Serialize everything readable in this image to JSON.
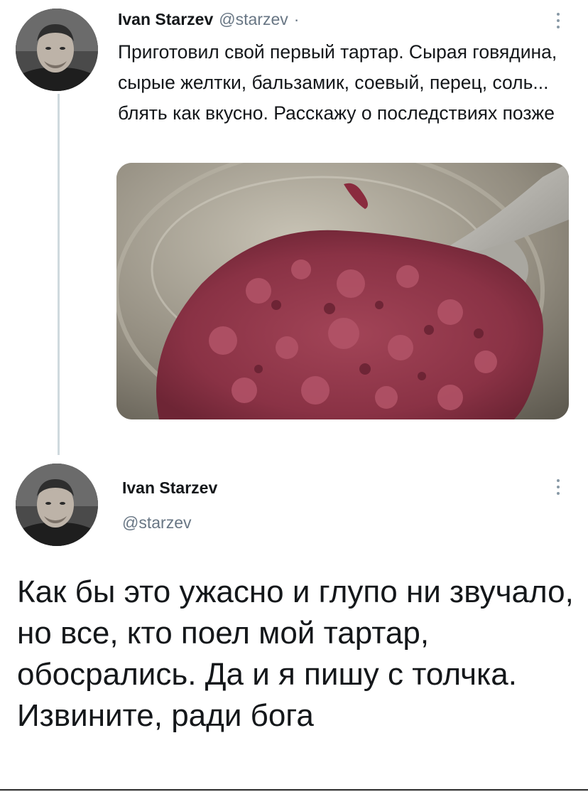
{
  "colors": {
    "text_primary": "#14171a",
    "text_secondary": "#687684",
    "thread_line": "#cfd9de",
    "more_icon": "#8899a6"
  },
  "tweet1": {
    "display_name": "Ivan Starzev",
    "handle": "@starzev",
    "separator": "·",
    "text": "Приготовил свой первый тартар. Сырая говядина, сырые желтки, бальзамик, соевый, перец, соль... блять как вкусно. Расскажу о последствиях позже",
    "more_icon": "more-vertical-icon",
    "media": "photo of raw beef tartare in a glass bowl with a spoon"
  },
  "tweet2": {
    "display_name": "Ivan Starzev",
    "handle": "@starzev",
    "text": "Как бы это ужасно и глупо ни звучало, но все, кто поел мой тартар, обосрались. Да и я пишу с толчка. Извините, ради бога",
    "more_icon": "more-vertical-icon"
  }
}
